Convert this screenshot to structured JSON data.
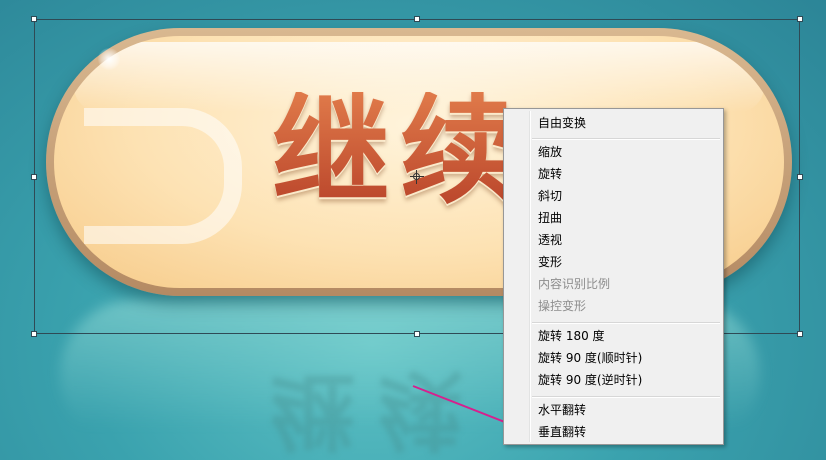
{
  "canvas": {
    "button_text": "继续",
    "button_text_colors": [
      "#e07a4a",
      "#b9442a"
    ],
    "background_color": "#3aa2ae"
  },
  "context_menu": {
    "items": [
      {
        "label": "自由变换",
        "enabled": true
      },
      {
        "label": "缩放",
        "enabled": true
      },
      {
        "label": "旋转",
        "enabled": true
      },
      {
        "label": "斜切",
        "enabled": true
      },
      {
        "label": "扭曲",
        "enabled": true
      },
      {
        "label": "透视",
        "enabled": true
      },
      {
        "label": "变形",
        "enabled": true
      },
      {
        "label": "内容识别比例",
        "enabled": false
      },
      {
        "label": "操控变形",
        "enabled": false
      },
      {
        "label": "旋转 180 度",
        "enabled": true
      },
      {
        "label": "旋转 90 度(顺时针)",
        "enabled": true
      },
      {
        "label": "旋转 90 度(逆时针)",
        "enabled": true
      },
      {
        "label": "水平翻转",
        "enabled": true
      },
      {
        "label": "垂直翻转",
        "enabled": true
      }
    ]
  },
  "annotation": {
    "arrow_color": "#d6208e",
    "target_item": "垂直翻转"
  }
}
